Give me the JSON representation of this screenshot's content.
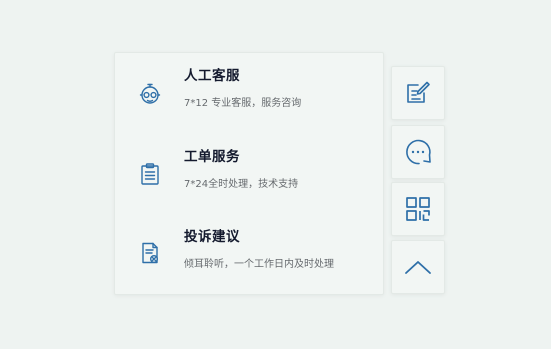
{
  "colors": {
    "background": "#eef3f1",
    "panel": "#f2f6f4",
    "icon": "#2e6fa8",
    "title": "#141a2e",
    "subtitle": "#666a6e"
  },
  "services": [
    {
      "title": "人工客服",
      "subtitle": "7*12 专业客服，服务咨询",
      "icon": "customer-service-robot-icon"
    },
    {
      "title": "工单服务",
      "subtitle": "7*24全时处理，技术支持",
      "icon": "clipboard-icon"
    },
    {
      "title": "投诉建议",
      "subtitle": "倾耳聆听，一个工作日内及时处理",
      "icon": "complaint-document-icon"
    }
  ],
  "side_buttons": [
    {
      "icon": "edit-icon"
    },
    {
      "icon": "chat-bubble-icon"
    },
    {
      "icon": "qr-code-icon"
    },
    {
      "icon": "chevron-up-icon"
    }
  ]
}
